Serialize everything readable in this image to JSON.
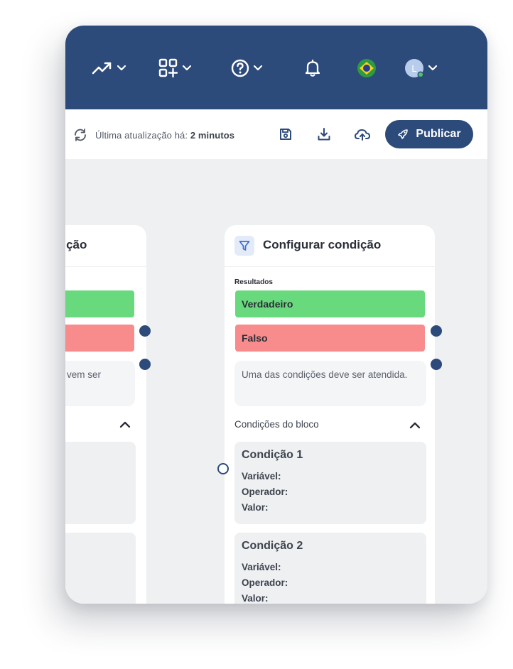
{
  "toolbar": {
    "sync_prefix": "Última atualização há:",
    "sync_time": "2 minutos",
    "publish_label": "Publicar"
  },
  "topbar": {
    "icons": [
      "trending-up-icon",
      "apps-add-icon",
      "help-icon",
      "bell-icon",
      "brazil-flag-icon",
      "user-avatar-icon"
    ],
    "avatar_letter": "L"
  },
  "left_card": {
    "title_fragment": "dição",
    "note_fragment": "vem ser"
  },
  "right_card": {
    "title": "Configurar condição",
    "results_label": "Resultados",
    "true_label": "Verdadeiro",
    "false_label": "Falso",
    "note": "Uma das condições deve ser atendida.",
    "section_label": "Condições do bloco",
    "conditions": [
      {
        "title": "Condição 1",
        "variable": "Variável:",
        "operator": "Operador:",
        "value": "Valor:"
      },
      {
        "title": "Condição 2",
        "variable": "Variável:",
        "operator": "Operador:",
        "value": "Valor:"
      }
    ]
  },
  "colors": {
    "primary": "#2c4a7a",
    "true_green": "#68d97c",
    "false_red": "#f88b8b",
    "canvas": "#eef0f2"
  }
}
